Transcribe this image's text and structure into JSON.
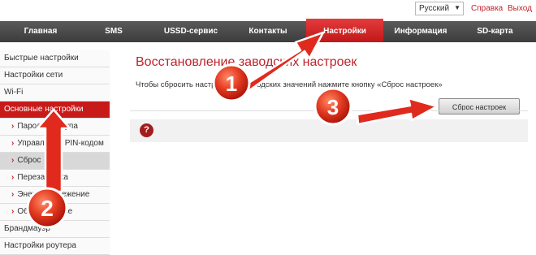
{
  "header": {
    "language": "Русский",
    "links": [
      "Справка",
      "Выход"
    ]
  },
  "nav": {
    "items": [
      "Главная",
      "SMS",
      "USSD-сервис",
      "Контакты",
      "Настройки",
      "Информация",
      "SD-карта"
    ],
    "active": "Настройки"
  },
  "sidebar": {
    "items": [
      {
        "label": "Быстрые настройки"
      },
      {
        "label": "Настройки сети"
      },
      {
        "label": "Wi-Fi"
      },
      {
        "label": "Основные настройки"
      },
      {
        "label": "Пароль доступа"
      },
      {
        "label": "Управление PIN-кодом"
      },
      {
        "label": "Сброс"
      },
      {
        "label": "Перезагрузка"
      },
      {
        "label": "Энергосбережение"
      },
      {
        "label": "Об устройстве"
      },
      {
        "label": "Брандмауэр"
      },
      {
        "label": "Настройки роутера"
      }
    ]
  },
  "main": {
    "title": "Восстановление заводских настроек",
    "description": "Чтобы сбросить настройки до заводских значений нажмите кнопку «Сброс настроек»",
    "reset_button": "Сброс настроек",
    "help_icon": "?"
  },
  "annotations": [
    "1",
    "2",
    "3"
  ],
  "colors": {
    "accent": "#c0232b",
    "nav": "#4a4a4a"
  }
}
